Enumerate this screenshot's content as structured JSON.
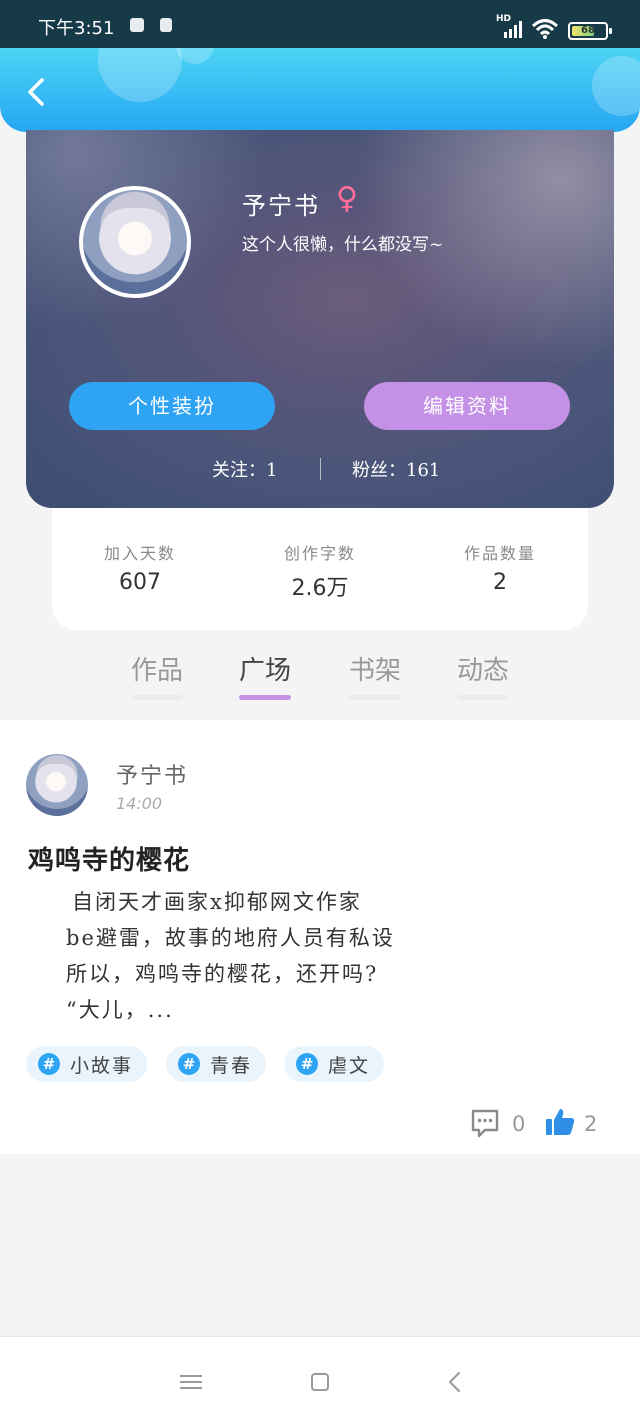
{
  "status_bar": {
    "time": "下午3:51",
    "network": "HD",
    "battery": "68",
    "battery_level": 0.68
  },
  "header": {
    "back_icon": "chevron-left-icon"
  },
  "profile": {
    "name": "予宁书",
    "gender_symbol": "♀",
    "bio": "这个人很懒，什么都没写~",
    "buttons": {
      "dress_up": "个性装扮",
      "edit_profile": "编辑资料"
    },
    "follow": "关注：1",
    "fans": "粉丝：161"
  },
  "stats": [
    {
      "label": "加入天数",
      "value": "607"
    },
    {
      "label": "创作字数",
      "value": "2.6万"
    },
    {
      "label": "作品数量",
      "value": "2"
    }
  ],
  "tabs": [
    {
      "label": "作品",
      "active": false
    },
    {
      "label": "广场",
      "active": true
    },
    {
      "label": "书架",
      "active": false
    },
    {
      "label": "动态",
      "active": false
    }
  ],
  "post": {
    "author": "予宁书",
    "time": "14:00",
    "title": "鸡鸣寺的樱花",
    "body_lines": [
      "自闭天才画家x抑郁网文作家",
      "be避雷，故事的地府人员有私设",
      "所以，鸡鸣寺的樱花，还开吗?",
      "“大儿，..."
    ],
    "tags": [
      {
        "symbol": "#",
        "label": "小故事"
      },
      {
        "symbol": "#",
        "label": "青春"
      },
      {
        "symbol": "#",
        "label": "虐文"
      }
    ],
    "comments": "0",
    "likes": "2"
  },
  "colors": {
    "header_top": "#4dd4f5",
    "header_bottom": "#27a6f3",
    "button_blue": "#2fa3f4",
    "button_purple": "#c491e6",
    "tab_underline_active": "#c491e6",
    "gender_pink": "#ff6f9a",
    "like_blue": "#2f8fe6"
  },
  "system_nav": {
    "menu_icon": "menu-icon",
    "home_icon": "home-square-icon",
    "back_icon": "back-chevron-icon"
  }
}
